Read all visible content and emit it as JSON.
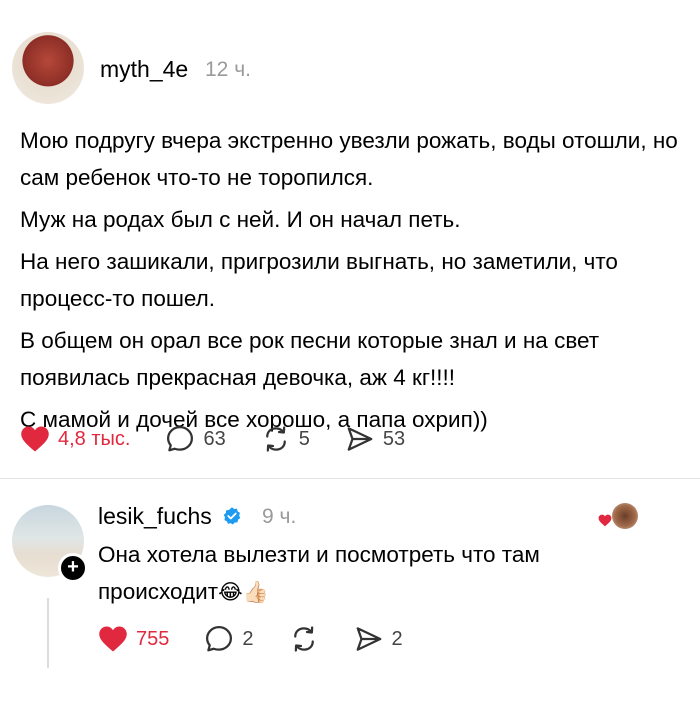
{
  "post": {
    "username": "myth_4e",
    "time": "12 ч.",
    "lines": [
      "Мою подругу вчера экстренно увезли рожать, воды отошли, но сам ребенок что-то не торопился.",
      "Муж на родах был с ней. И он начал петь.",
      "На него зашикали, пригрозили выгнать, но заметили, что процесс-то пошел.",
      "В общем он орал все рок песни которые знал и на свет появилась прекрасная девочка, аж 4 кг!!!!",
      "С мамой и дочей все хорошо, а папа охрип))"
    ],
    "likes": "4,8 тыс.",
    "comments": "63",
    "reposts": "5",
    "shares": "53"
  },
  "reply": {
    "username": "lesik_fuchs",
    "time": "9 ч.",
    "text": "Она хотела вылезти и посмотреть что там происходит",
    "emoji": "😂👍🏻",
    "likes": "755",
    "comments": "2",
    "shares": "2",
    "plus": "+"
  },
  "colors": {
    "like": "#e0283f",
    "verified": "#1d9bf0",
    "muted": "#9a9a9a"
  }
}
